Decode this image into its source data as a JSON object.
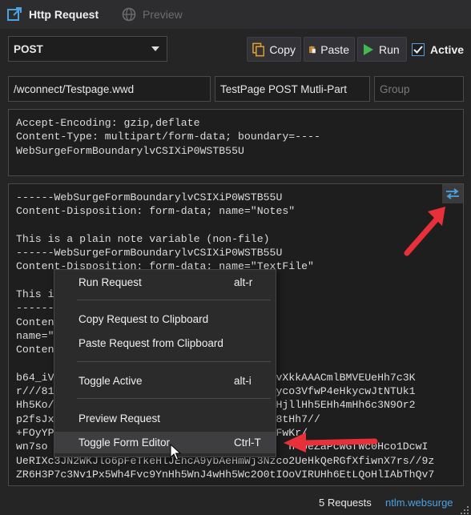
{
  "tabs": {
    "http_request": "Http Request",
    "preview": "Preview"
  },
  "toolbar": {
    "method": "POST",
    "copy": "Copy",
    "paste": "Paste",
    "run": "Run",
    "active_label": "Active",
    "active_checked": true
  },
  "request": {
    "url": "/wconnect/Testpage.wwd",
    "name": "TestPage POST Mutli-Part",
    "group_placeholder": "Group"
  },
  "headers_text": "Accept-Encoding: gzip,deflate\nContent-Type: multipart/form-data; boundary=----\nWebSurgeFormBoundarylvCSIXiP0WSTB55U",
  "body_lines": [
    "------WebSurgeFormBoundarylvCSIXiP0WSTB55U",
    "Content-Disposition: form-data; name=\"Notes\"",
    "",
    "This is a plain note variable (non-file)",
    "------WebSurgeFormBoundarylvCSIXiP0WSTB55U",
    "Content-Disposition: form-data; name=\"TextFile\"",
    "",
    "This i",
    "------                              55U",
    "Conten",
    "name=\"                              .",
    "Conten",
    "",
    "b64_iV                              AAABgvXkkAAACmlBMVEUeHh7c3K",
    "r///81                              3KrLCyco3VfwP4eHkycwJtNTUk1",
    "Hh5Ko/                              lr7AeHjllHh5EHh4mHh6c3N9Or2",
    "p2fsJx                              H2rwv8tHh7//",
    "+FOyYP                              Hh5NaFwKr/",
    "wn7so                                      hlUeZaPcwGfWc0Hco1DcwI",
    "UeRIXc3JN2WKJlo6pFeTkeHlJEhcA9ybAeHmWj3Nzco2UeHkQeRGfXfiwnX7rs//9z",
    "ZR6H3P7c3Nv1Px5Wh4Fvc9YnHh5WnJ4wHh5Wc2O0tIOoVIRUHh6EtLQoHlIAbThQv7"
  ],
  "context_menu": {
    "items": [
      {
        "label": "Run Request",
        "shortcut": "alt-r"
      },
      {
        "label": "Copy Request to Clipboard",
        "shortcut": ""
      },
      {
        "label": "Paste Request from Clipboard",
        "shortcut": ""
      },
      {
        "label": "Toggle Active",
        "shortcut": "alt-i"
      },
      {
        "label": "Preview Request",
        "shortcut": ""
      },
      {
        "label": "Toggle Form Editor",
        "shortcut": "Ctrl-T"
      }
    ]
  },
  "status": {
    "requests": "5 Requests",
    "file": "ntlm.websurge"
  },
  "colors": {
    "accent": "#569cd6",
    "run_green": "#3fb950",
    "annotation_red": "#e8303a",
    "link": "#4aa3e0"
  }
}
